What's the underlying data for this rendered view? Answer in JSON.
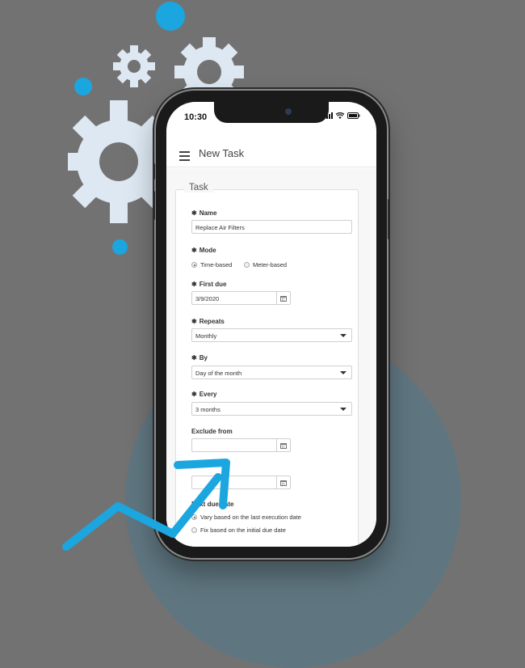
{
  "colors": {
    "accent": "#1ba6e0",
    "gear": "#dde8f2",
    "background": "#737272",
    "circle": "#5f7680"
  },
  "status_bar": {
    "time": "10:30",
    "icons": [
      "signal-icon",
      "wifi-icon",
      "battery-icon"
    ]
  },
  "app_bar": {
    "title": "New Task",
    "menu_icon": "hamburger-menu-icon"
  },
  "form": {
    "legend": "Task",
    "name": {
      "label": "Name",
      "required_mark": "✱",
      "value": "Replace Air Filters"
    },
    "mode": {
      "label": "Mode",
      "required_mark": "✱",
      "options": [
        {
          "label": "Time-based",
          "selected": true
        },
        {
          "label": "Meter-based",
          "selected": false
        }
      ]
    },
    "first_due": {
      "label": "First due",
      "required_mark": "✱",
      "value": "3/9/2020",
      "icon": "calendar-icon"
    },
    "repeats": {
      "label": "Repeats",
      "required_mark": "✱",
      "value": "Monthly"
    },
    "by": {
      "label": "By",
      "required_mark": "✱",
      "value": "Day of the month"
    },
    "every": {
      "label": "Every",
      "required_mark": "✱",
      "value": "3 months"
    },
    "exclude_from": {
      "label": "Exclude from",
      "value": "",
      "icon": "calendar-icon"
    },
    "exclude_to": {
      "label": "",
      "value": "",
      "icon": "calendar-icon"
    },
    "next_due_date": {
      "label": "Next due date",
      "options": [
        {
          "label": "Vary based on the last execution date",
          "selected": true
        },
        {
          "label": "Fix based on the initial due date",
          "selected": false
        }
      ]
    }
  }
}
